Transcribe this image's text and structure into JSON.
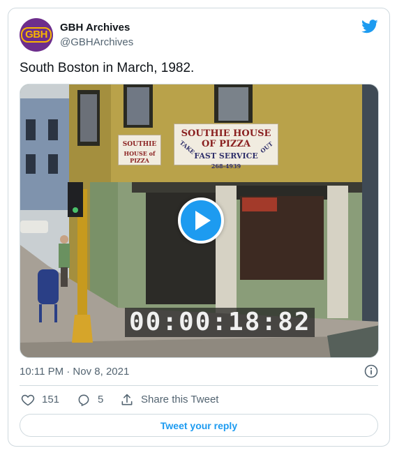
{
  "author": {
    "name": "GBH Archives",
    "handle": "@GBHArchives",
    "avatar_text": "GBH"
  },
  "tweet": {
    "text": "South Boston in March, 1982.",
    "timestamp": "10:11 PM · Nov 8, 2021"
  },
  "media": {
    "timecode": "00:00:18:82",
    "sign_main_title": "SOUTHIE HOUSE OF PIZZA",
    "sign_main_sub": "FAST SERVICE",
    "sign_main_take": "TAKE",
    "sign_main_out": "OUT",
    "sign_main_phone": "268-4939",
    "sign_side_line1": "SOUTHIE",
    "sign_side_line2": "HOUSE of PIZZA"
  },
  "actions": {
    "likes": "151",
    "replies": "5",
    "share_label": "Share this Tweet"
  },
  "reply_button": "Tweet your reply",
  "colors": {
    "accent": "#1d9bf0",
    "avatar_bg": "#6d2e8c",
    "avatar_logo": "#f7b500",
    "muted_text": "#536471",
    "border": "#cfd9de"
  }
}
